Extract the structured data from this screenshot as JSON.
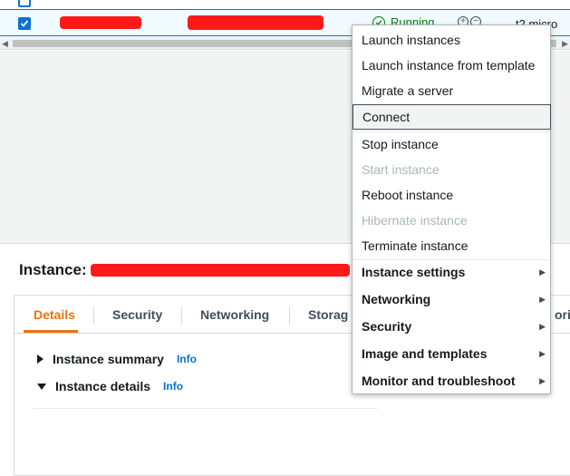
{
  "instance_row": {
    "status": "Running",
    "instance_type": "t2.micro"
  },
  "details": {
    "title_prefix": "Instance:",
    "tabs": [
      {
        "label": "Details"
      },
      {
        "label": "Security"
      },
      {
        "label": "Networking"
      },
      {
        "label": "Storag"
      },
      {
        "label": "orin"
      }
    ],
    "sections": [
      {
        "label": "Instance summary",
        "info": "Info",
        "expanded": false
      },
      {
        "label": "Instance details",
        "info": "Info",
        "expanded": true
      }
    ]
  },
  "menu": {
    "items": [
      {
        "label": "Launch instances"
      },
      {
        "label": "Launch instance from template"
      },
      {
        "label": "Migrate a server"
      },
      {
        "label": "Connect"
      },
      {
        "label": "Stop instance"
      },
      {
        "label": "Start instance",
        "disabled": true
      },
      {
        "label": "Reboot instance"
      },
      {
        "label": "Hibernate instance",
        "disabled": true
      },
      {
        "label": "Terminate instance"
      },
      {
        "label": "Instance settings",
        "submenu": true
      },
      {
        "label": "Networking",
        "submenu": true
      },
      {
        "label": "Security",
        "submenu": true
      },
      {
        "label": "Image and templates",
        "submenu": true
      },
      {
        "label": "Monitor and troubleshoot",
        "submenu": true
      }
    ]
  },
  "colors": {
    "accent": "#0972d3",
    "tab_active": "#ec7211",
    "running": "#037f0c",
    "redaction": "#ff1a1a"
  }
}
